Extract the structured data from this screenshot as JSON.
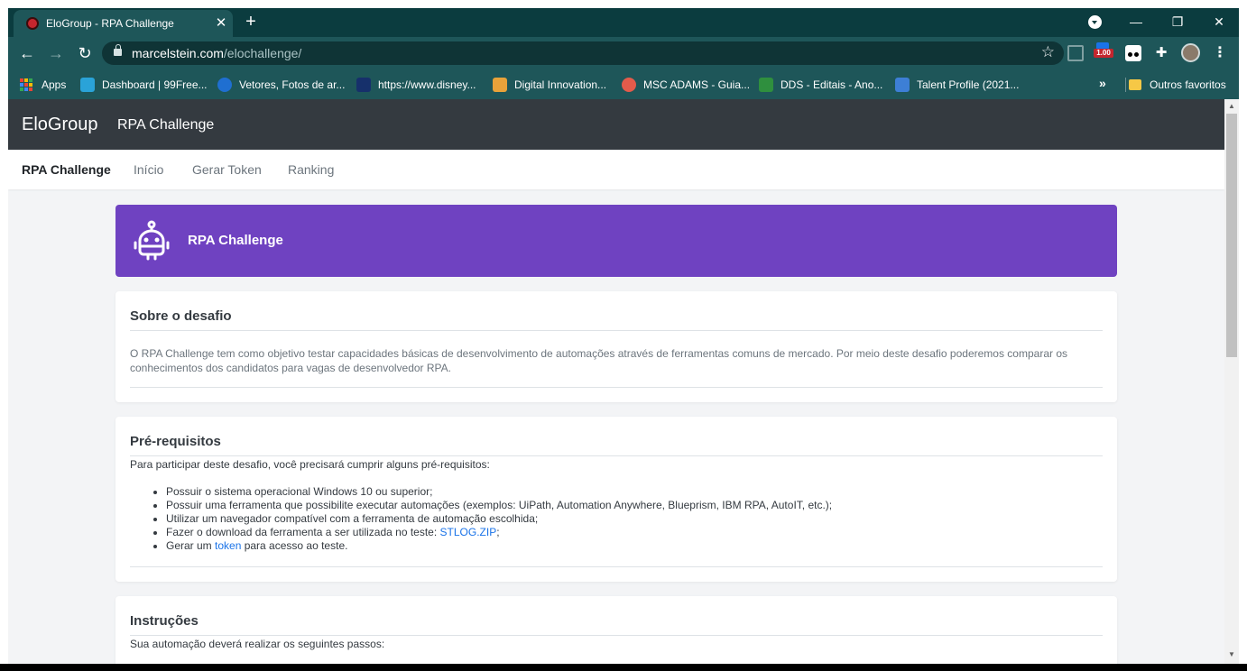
{
  "browser": {
    "tab": {
      "title": "EloGroup - RPA Challenge"
    },
    "url": {
      "host": "marcelstein.com",
      "path": "/elochallenge/"
    },
    "extension_badge": "1.00",
    "bookmarks": [
      {
        "label": "Apps",
        "icon": "apps-grid-icon"
      },
      {
        "label": "Dashboard | 99Free...",
        "icon": "99freelas-icon"
      },
      {
        "label": "Vetores, Fotos de ar...",
        "icon": "freepik-icon"
      },
      {
        "label": "https://www.disney...",
        "icon": "disney-icon"
      },
      {
        "label": "Digital Innovation...",
        "icon": "dio-icon"
      },
      {
        "label": "MSC ADAMS - Guia...",
        "icon": "target-icon"
      },
      {
        "label": "DDS - Editais - Ano...",
        "icon": "dds-icon"
      },
      {
        "label": "Talent Profile (2021...",
        "icon": "talent-icon"
      }
    ],
    "bookmarks_more": "»",
    "other_bookmarks": "Outros favoritos"
  },
  "app": {
    "brand": "EloGroup",
    "title": "RPA Challenge",
    "nav": [
      {
        "label": "RPA Challenge",
        "active": true
      },
      {
        "label": "Início"
      },
      {
        "label": "Gerar Token"
      },
      {
        "label": "Ranking"
      }
    ],
    "accent_color": "#6f42c1"
  },
  "hero": {
    "title": "RPA Challenge"
  },
  "about": {
    "title": "Sobre o desafio",
    "text": "O RPA Challenge tem como objetivo testar capacidades básicas de desenvolvimento de automações através de ferramentas comuns de mercado. Por meio deste desafio poderemos comparar os conhecimentos dos candidatos para vagas de desenvolvedor RPA."
  },
  "prereq": {
    "title": "Pré-requisitos",
    "intro": "Para participar deste desafio, você precisará cumprir alguns pré-requisitos:",
    "items": {
      "item1": "Possuir o sistema operacional Windows 10 ou superior;",
      "item2": "Possuir uma ferramenta que possibilite executar automações (exemplos: UiPath, Automation Anywhere, Blueprism, IBM RPA, AutoIT, etc.);",
      "item3": "Utilizar um navegador compatível com a ferramenta de automação escolhida;",
      "item4_text": "Fazer o download da ferramenta a ser utilizada no teste: ",
      "item4_link": "STLOG.ZIP",
      "item4_end": ";",
      "item5_text": "Gerar um ",
      "item5_link": "token",
      "item5_end": " para acesso ao teste."
    }
  },
  "instructions": {
    "title": "Instruções",
    "intro": "Sua automação deverá realizar os seguintes passos:"
  }
}
